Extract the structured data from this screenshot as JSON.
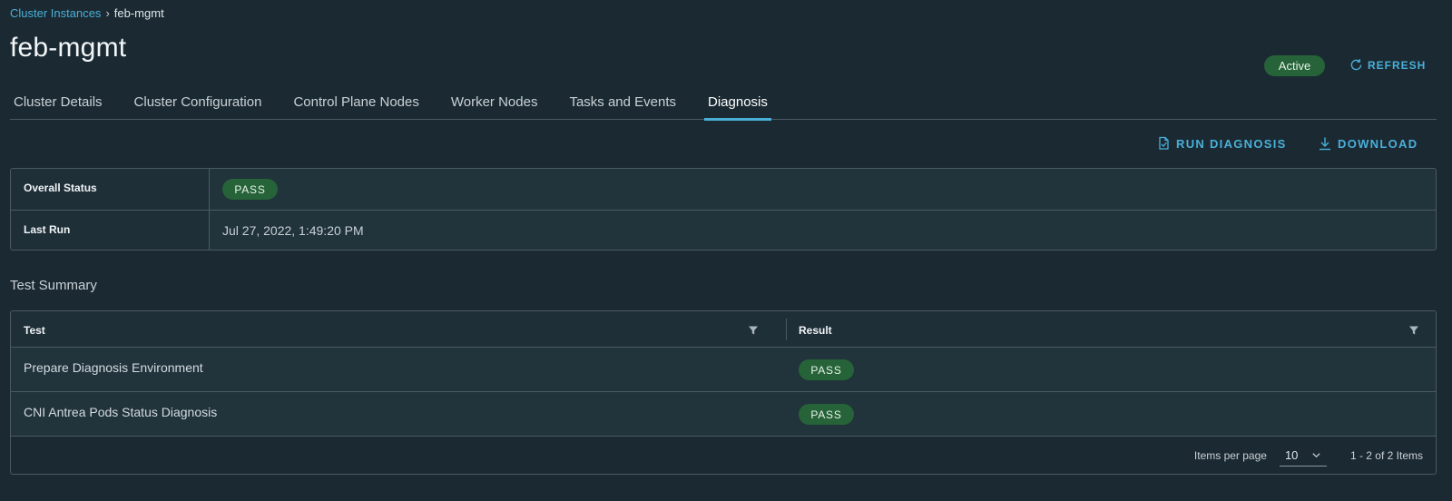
{
  "breadcrumb": {
    "parent": "Cluster Instances",
    "separator": "›",
    "current": "feb-mgmt"
  },
  "title": "feb-mgmt",
  "status": "Active",
  "refresh_label": "REFRESH",
  "tabs": [
    {
      "label": "Cluster Details",
      "active": false
    },
    {
      "label": "Cluster Configuration",
      "active": false
    },
    {
      "label": "Control Plane Nodes",
      "active": false
    },
    {
      "label": "Worker Nodes",
      "active": false
    },
    {
      "label": "Tasks and Events",
      "active": false
    },
    {
      "label": "Diagnosis",
      "active": true
    }
  ],
  "actions": {
    "run_diagnosis": "RUN DIAGNOSIS",
    "download": "DOWNLOAD"
  },
  "summary": {
    "overall_status_label": "Overall Status",
    "overall_status_value": "PASS",
    "last_run_label": "Last Run",
    "last_run_value": "Jul 27, 2022, 1:49:20 PM"
  },
  "test_summary": {
    "title": "Test Summary",
    "columns": [
      "Test",
      "Result"
    ],
    "rows": [
      {
        "test": "Prepare Diagnosis Environment",
        "result": "PASS"
      },
      {
        "test": "CNI Antrea Pods Status Diagnosis",
        "result": "PASS"
      }
    ],
    "footer": {
      "items_per_page_label": "Items per page",
      "page_size": "10",
      "range": "1 - 2 of 2 Items"
    }
  },
  "colors": {
    "background": "#1b2a32",
    "accent": "#49afd9",
    "success": "#266338"
  }
}
